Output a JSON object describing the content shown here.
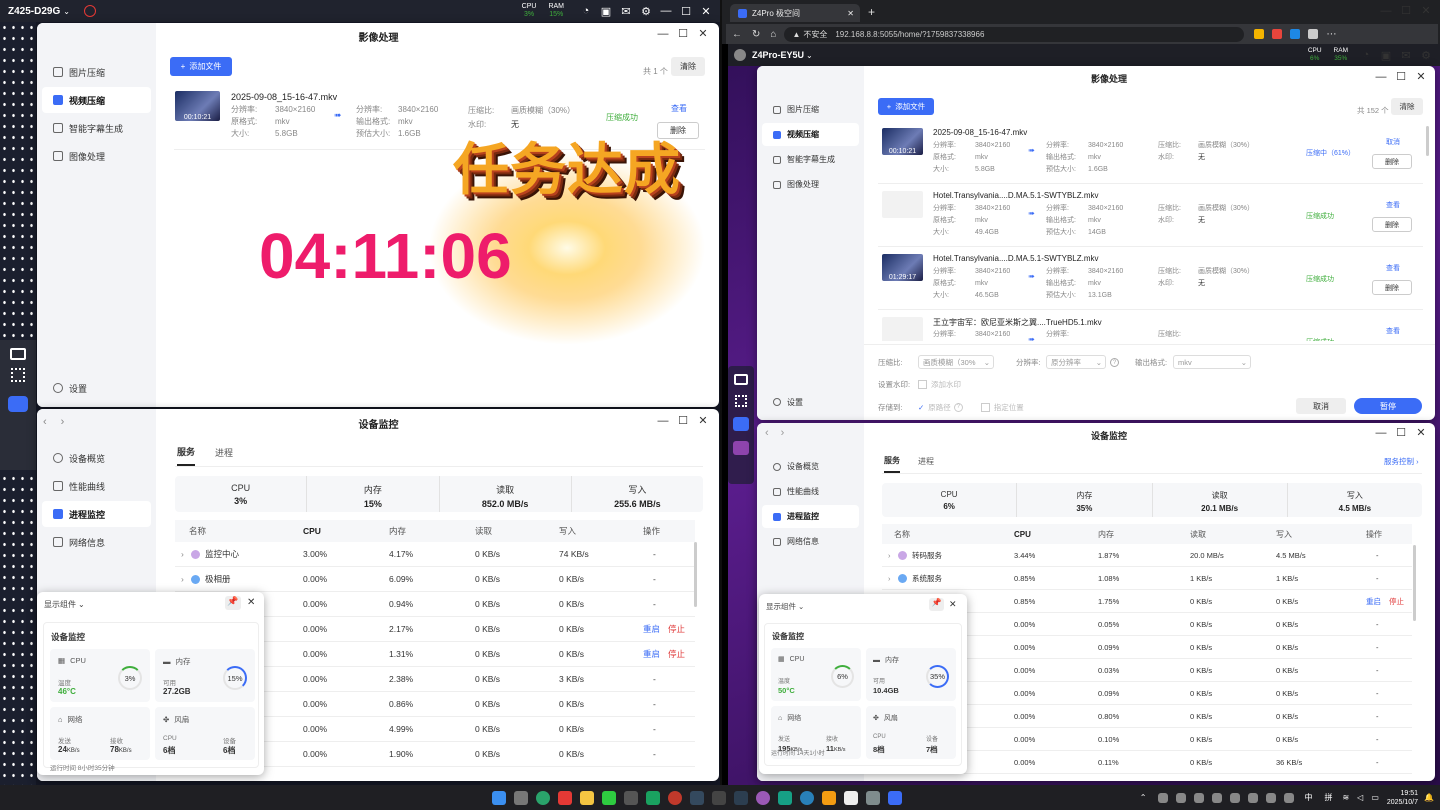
{
  "left_topbar": {
    "device": "Z425-D29G",
    "cpu_label": "CPU",
    "cpu_val": "3%",
    "ram_label": "RAM",
    "ram_val": "15%"
  },
  "left_img": {
    "title": "影像处理",
    "sidebar": [
      "图片压缩",
      "视频压缩",
      "智能字幕生成",
      "图像处理"
    ],
    "settings": "设置",
    "add_btn": "添加文件",
    "count": "共 1 个",
    "clear": "清除",
    "file": {
      "name": "2025-09-08_15-16-47.mkv",
      "duration": "00:10:21",
      "res_l": "分辨率:",
      "res": "3840×2160",
      "fmt_l": "原格式:",
      "fmt": "mkv",
      "size_l": "大小:",
      "size": "5.8GB",
      "res2_l": "分辨率:",
      "res2": "3840×2160",
      "ofmt_l": "输出格式:",
      "ofmt": "mkv",
      "est_l": "预估大小:",
      "est": "1.6GB",
      "ratio_l": "压缩比:",
      "ratio": "画质模糊（30%）",
      "wm_l": "水印:",
      "wm": "无",
      "status": "压缩成功",
      "view": "查看",
      "del": "删除"
    },
    "banner": "任务达成",
    "timer": "04:11:06"
  },
  "left_mon": {
    "title": "设备监控",
    "sidebar": [
      "设备概览",
      "性能曲线",
      "进程监控",
      "网络信息"
    ],
    "tabs": [
      "服务",
      "进程"
    ],
    "summary": [
      {
        "k": "CPU",
        "v": "3%"
      },
      {
        "k": "内存",
        "v": "15%"
      },
      {
        "k": "读取",
        "v": "852.0 MB/s"
      },
      {
        "k": "写入",
        "v": "255.6 MB/s"
      }
    ],
    "cols": [
      "名称",
      "CPU",
      "内存",
      "读取",
      "写入",
      "操作"
    ],
    "rows": [
      {
        "name": "监控中心",
        "cpu": "3.00%",
        "mem": "4.17%",
        "read": "0 KB/s",
        "write": "74 KB/s",
        "op1": "",
        "op2": "-"
      },
      {
        "name": "极相册",
        "cpu": "0.00%",
        "mem": "6.09%",
        "read": "0 KB/s",
        "write": "0 KB/s",
        "op1": "",
        "op2": "-"
      },
      {
        "name": "",
        "cpu": "0.00%",
        "mem": "0.94%",
        "read": "0 KB/s",
        "write": "0 KB/s",
        "op1": "",
        "op2": "-"
      },
      {
        "name": "",
        "cpu": "0.00%",
        "mem": "2.17%",
        "read": "0 KB/s",
        "write": "0 KB/s",
        "op1": "重启",
        "op2": "停止"
      },
      {
        "name": "",
        "cpu": "0.00%",
        "mem": "1.31%",
        "read": "0 KB/s",
        "write": "0 KB/s",
        "op1": "重启",
        "op2": "停止"
      },
      {
        "name": "",
        "cpu": "0.00%",
        "mem": "2.38%",
        "read": "0 KB/s",
        "write": "3 KB/s",
        "op1": "",
        "op2": "-"
      },
      {
        "name": "",
        "cpu": "0.00%",
        "mem": "0.86%",
        "read": "0 KB/s",
        "write": "0 KB/s",
        "op1": "",
        "op2": "-"
      },
      {
        "name": "",
        "cpu": "0.00%",
        "mem": "4.99%",
        "read": "0 KB/s",
        "write": "0 KB/s",
        "op1": "",
        "op2": "-"
      },
      {
        "name": "",
        "cpu": "0.00%",
        "mem": "1.90%",
        "read": "0 KB/s",
        "write": "0 KB/s",
        "op1": "",
        "op2": "-"
      }
    ]
  },
  "left_widget": {
    "header": "显示组件",
    "title": "设备监控",
    "cpu": "CPU",
    "temp_l": "温度",
    "temp": "46°C",
    "cpu_pct": "3%",
    "mem": "内存",
    "avail_l": "可用",
    "avail": "27.2GB",
    "mem_pct": "15%",
    "net": "网络",
    "send_l": "发送",
    "send": "24",
    "send_u": "KB/s",
    "recv_l": "接收",
    "recv": "78",
    "recv_u": "KB/s",
    "fan": "风扇",
    "fan_cpu_l": "CPU",
    "fan_cpu": "6档",
    "fan_dev_l": "设备",
    "fan_dev": "6档",
    "uptime": "运行时间 8小时35分钟"
  },
  "browser": {
    "tab": "Z4Pro 极空间",
    "insecure": "不安全",
    "url": "192.168.8.8:5055/home/?1759837338966"
  },
  "right_topbar": {
    "device": "Z4Pro-EY5U",
    "cpu_label": "CPU",
    "cpu_val": "6%",
    "ram_label": "RAM",
    "ram_val": "35%"
  },
  "right_img": {
    "title": "影像处理",
    "sidebar": [
      "图片压缩",
      "视频压缩",
      "智能字幕生成",
      "图像处理"
    ],
    "settings": "设置",
    "add_btn": "添加文件",
    "count": "共 152 个",
    "clear": "清除",
    "files": [
      {
        "name": "2025-09-08_15-16-47.mkv",
        "dur": "00:10:21",
        "res": "3840×2160",
        "fmt": "mkv",
        "size": "5.8GB",
        "res2": "3840×2160",
        "ofmt": "mkv",
        "est": "1.6GB",
        "ratio": "画质模糊（30%）",
        "wm": "无",
        "status": "压缩中（61%）",
        "a1": "取消",
        "a2": "删除"
      },
      {
        "name": "Hotel.Transylvania....D.MA.5.1-SWTYBLZ.mkv",
        "dur": "",
        "res": "3840×2160",
        "fmt": "mkv",
        "size": "49.4GB",
        "res2": "3840×2160",
        "ofmt": "mkv",
        "est": "14GB",
        "ratio": "画质模糊（30%）",
        "wm": "无",
        "status": "压缩成功",
        "a1": "查看",
        "a2": "删除"
      },
      {
        "name": "Hotel.Transylvania....D.MA.5.1-SWTYBLZ.mkv",
        "dur": "01:29:17",
        "res": "3840×2160",
        "fmt": "mkv",
        "size": "46.5GB",
        "res2": "3840×2160",
        "ofmt": "mkv",
        "est": "13.1GB",
        "ratio": "画质模糊（30%）",
        "wm": "无",
        "status": "压缩成功",
        "a1": "查看",
        "a2": "删除"
      },
      {
        "name": "王立宇宙军：欧尼亚米斯之翼....TrueHD5.1.mkv",
        "dur": "",
        "res": "3840×2160",
        "fmt": "",
        "size": "",
        "res2": "",
        "ofmt": "",
        "est": "",
        "ratio": "",
        "wm": "",
        "status": "压缩成功",
        "a1": "查看",
        "a2": ""
      }
    ],
    "labels": {
      "res": "分辨率:",
      "fmt": "原格式:",
      "size": "大小:",
      "res2": "分辨率:",
      "ofmt": "输出格式:",
      "est": "预估大小:",
      "ratio": "压缩比:",
      "wm": "水印:"
    },
    "opts": {
      "ratio_l": "压缩比:",
      "ratio": "画质模糊（30%",
      "res_l": "分辨率:",
      "res": "原分辨率",
      "fmt_l": "输出格式:",
      "fmt": "mkv",
      "wm_l": "设置水印:",
      "wm": "添加水印",
      "save_l": "存储到:",
      "save1": "原路径",
      "save2": "指定位置",
      "cancel": "取消",
      "pause": "暂停"
    }
  },
  "right_mon": {
    "title": "设备监控",
    "sidebar": [
      "设备概览",
      "性能曲线",
      "进程监控",
      "网络信息"
    ],
    "tabs": [
      "服务",
      "进程"
    ],
    "svc_ctrl": "服务控制",
    "summary": [
      {
        "k": "CPU",
        "v": "6%"
      },
      {
        "k": "内存",
        "v": "35%"
      },
      {
        "k": "读取",
        "v": "20.1 MB/s"
      },
      {
        "k": "写入",
        "v": "4.5 MB/s"
      }
    ],
    "cols": [
      "名称",
      "CPU",
      "内存",
      "读取",
      "写入",
      "操作"
    ],
    "rows": [
      {
        "name": "转码服务",
        "cpu": "3.44%",
        "mem": "1.87%",
        "read": "20.0 MB/s",
        "write": "4.5 MB/s",
        "op1": "",
        "op2": "-"
      },
      {
        "name": "系统服务",
        "cpu": "0.85%",
        "mem": "1.08%",
        "read": "1 KB/s",
        "write": "1 KB/s",
        "op1": "",
        "op2": "-"
      },
      {
        "name": "",
        "cpu": "0.85%",
        "mem": "1.75%",
        "read": "0 KB/s",
        "write": "0 KB/s",
        "op1": "重启",
        "op2": "停止"
      },
      {
        "name": "",
        "cpu": "0.00%",
        "mem": "0.05%",
        "read": "0 KB/s",
        "write": "0 KB/s",
        "op1": "",
        "op2": "-"
      },
      {
        "name": "",
        "cpu": "0.00%",
        "mem": "0.09%",
        "read": "0 KB/s",
        "write": "0 KB/s",
        "op1": "",
        "op2": "-"
      },
      {
        "name": "",
        "cpu": "0.00%",
        "mem": "0.03%",
        "read": "0 KB/s",
        "write": "0 KB/s",
        "op1": "",
        "op2": "-"
      },
      {
        "name": "",
        "cpu": "0.00%",
        "mem": "0.09%",
        "read": "0 KB/s",
        "write": "0 KB/s",
        "op1": "",
        "op2": "-"
      },
      {
        "name": "",
        "cpu": "0.00%",
        "mem": "0.80%",
        "read": "0 KB/s",
        "write": "0 KB/s",
        "op1": "",
        "op2": "-"
      },
      {
        "name": "",
        "cpu": "0.00%",
        "mem": "0.10%",
        "read": "0 KB/s",
        "write": "0 KB/s",
        "op1": "",
        "op2": "-"
      },
      {
        "name": "",
        "cpu": "0.00%",
        "mem": "0.11%",
        "read": "0 KB/s",
        "write": "36 KB/s",
        "op1": "",
        "op2": "-"
      }
    ]
  },
  "right_widget": {
    "header": "显示组件",
    "title": "设备监控",
    "cpu": "CPU",
    "temp_l": "温度",
    "temp": "50°C",
    "cpu_pct": "6%",
    "mem": "内存",
    "avail_l": "可用",
    "avail": "10.4GB",
    "mem_pct": "35%",
    "net": "网络",
    "send_l": "发送",
    "send": "195",
    "send_u": "KB/s",
    "recv_l": "接收",
    "recv": "11",
    "recv_u": "KB/s",
    "fan": "风扇",
    "fan_cpu_l": "CPU",
    "fan_cpu": "8档",
    "fan_dev_l": "设备",
    "fan_dev": "7档",
    "uptime": "运行时间 14天1小时"
  },
  "taskbar": {
    "ime": "中",
    "ime2": "拼",
    "time": "19:51",
    "date": "2025/10/7"
  }
}
